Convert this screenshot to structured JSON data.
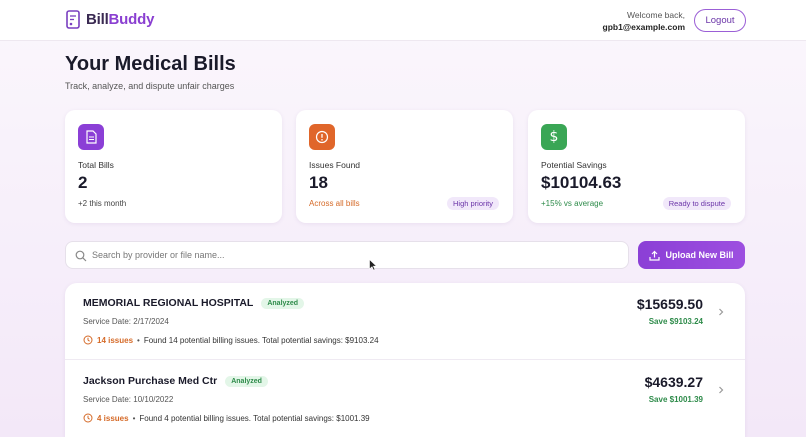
{
  "header": {
    "brand_bill": "Bill",
    "brand_buddy": "Buddy",
    "welcome_label": "Welcome back,",
    "user_email": "gpb1@example.com",
    "logout_label": "Logout"
  },
  "page": {
    "title": "Your Medical Bills",
    "subtitle": "Track, analyze, and dispute unfair charges"
  },
  "stats": [
    {
      "icon": "document-icon",
      "icon_color": "#8b3fd6",
      "label": "Total Bills",
      "value": "2",
      "note": "+2 this month",
      "note_color": "#444444",
      "badge": ""
    },
    {
      "icon": "alert-circle-icon",
      "icon_color": "#e0662a",
      "label": "Issues Found",
      "value": "18",
      "note": "Across all bills",
      "note_color": "#d56a28",
      "badge": "High priority"
    },
    {
      "icon": "dollar-icon",
      "icon_color": "#3aa655",
      "label": "Potential Savings",
      "value": "$10104.63",
      "note": "+15% vs average",
      "note_color": "#2e8b4a",
      "badge": "Ready to dispute"
    }
  ],
  "search": {
    "placeholder": "Search by provider or file name...",
    "value": ""
  },
  "upload_label": "Upload New Bill",
  "bills": [
    {
      "provider": "MEMORIAL REGIONAL HOSPITAL",
      "status": "Analyzed",
      "service_date": "Service Date: 2/17/2024",
      "issue_count": "14 issues",
      "issue_desc": "Found 14 potential billing issues. Total potential savings: $9103.24",
      "amount": "$15659.50",
      "savings": "Save $9103.24"
    },
    {
      "provider": "Jackson Purchase Med Ctr",
      "status": "Analyzed",
      "service_date": "Service Date: 10/10/2022",
      "issue_count": "4 issues",
      "issue_desc": "Found 4 potential billing issues. Total potential savings: $1001.39",
      "amount": "$4639.27",
      "savings": "Save $1001.39"
    }
  ],
  "colors": {
    "accent": "#8b3fd6",
    "warning": "#d56a28",
    "success": "#2e8b4a"
  }
}
